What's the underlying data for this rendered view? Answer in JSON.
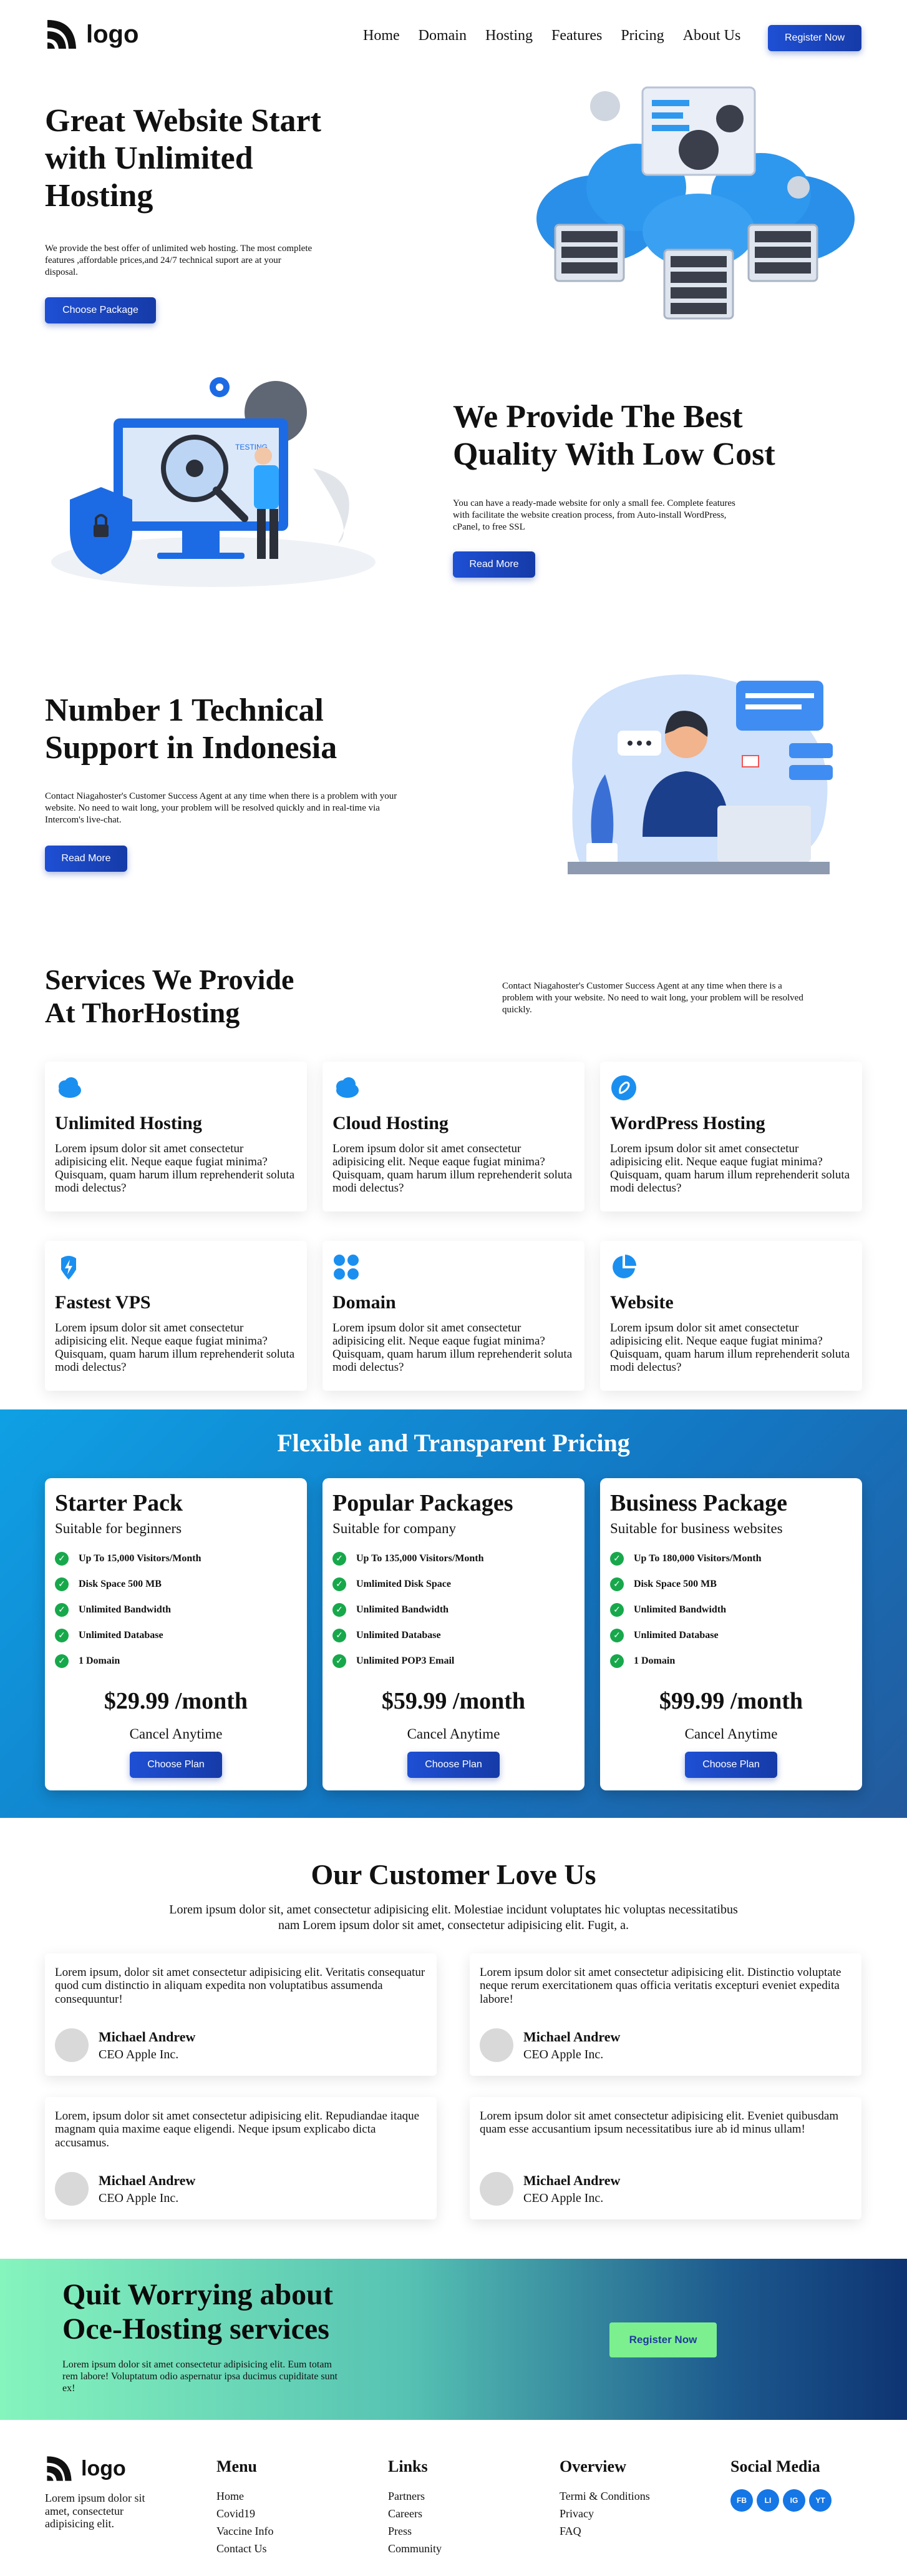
{
  "nav": {
    "logo": "logo",
    "items": [
      "Home",
      "Domain",
      "Hosting",
      "Features",
      "Pricing",
      "About Us"
    ],
    "register": "Register Now"
  },
  "hero": {
    "title_lines": [
      "Great Website Start",
      "with Unlimited",
      "Hosting"
    ],
    "text": "We provide the best offer of unlimited web hosting. The most complete features ,affordable prices,and 24/7 technical suport are at your disposal.",
    "button": "Choose Package"
  },
  "quality": {
    "title_lines": [
      "We Provide The Best",
      "Quality With Low Cost"
    ],
    "text": "You can have a ready-made website for only a small fee. Complete features with facilitate the website creation process, from Auto-install WordPress, cPanel, to free SSL",
    "button": "Read More",
    "illustration_label": "TESTING"
  },
  "support": {
    "title_lines": [
      "Number 1 Technical",
      "Support in Indonesia"
    ],
    "text": "Contact Niagahoster's Customer Success Agent at any time when there is a problem with your website. No need to wait long, your problem will be resolved quickly and in real-time via Intercom's live-chat.",
    "button": "Read More"
  },
  "services": {
    "title_lines": [
      "Services We Provide",
      "At ThorHosting"
    ],
    "intro": "Contact Niagahoster's Customer Success Agent at any time when there is a problem with your website. No need to wait long, your problem will be resolved quickly.",
    "items": [
      {
        "title": "Unlimited Hosting",
        "icon": "cloud-icon",
        "text": "Lorem ipsum dolor sit amet consectetur adipisicing elit. Neque eaque fugiat minima? Quisquam, quam harum illum reprehenderit soluta modi delectus?"
      },
      {
        "title": "Cloud Hosting",
        "icon": "cloud-icon",
        "text": "Lorem ipsum dolor sit amet consectetur adipisicing elit. Neque eaque fugiat minima? Quisquam, quam harum illum reprehenderit soluta modi delectus?"
      },
      {
        "title": "WordPress Hosting",
        "icon": "wordpress-icon",
        "text": "Lorem ipsum dolor sit amet consectetur adipisicing elit. Neque eaque fugiat minima? Quisquam, quam harum illum reprehenderit soluta modi delectus?"
      },
      {
        "title": "Fastest VPS",
        "icon": "lightning-icon",
        "text": "Lorem ipsum dolor sit amet consectetur adipisicing elit. Neque eaque fugiat minima? Quisquam, quam harum illum reprehenderit soluta modi delectus?"
      },
      {
        "title": "Domain",
        "icon": "grid-icon",
        "text": "Lorem ipsum dolor sit amet consectetur adipisicing elit. Neque eaque fugiat minima? Quisquam, quam harum illum reprehenderit soluta modi delectus?"
      },
      {
        "title": "Website",
        "icon": "pie-icon",
        "text": "Lorem ipsum dolor sit amet consectetur adipisicing elit. Neque eaque fugiat minima? Quisquam, quam harum illum reprehenderit soluta modi delectus?"
      }
    ]
  },
  "pricing": {
    "title": "Flexible and Transparent Pricing",
    "plans": [
      {
        "name": "Starter Pack",
        "sub": "Suitable for beginners",
        "features": [
          "Up To 15,000 Visitors/Month",
          "Disk Space 500 MB",
          "Unlimited Bandwidth",
          "Unlimited Database",
          "1 Domain"
        ],
        "price": "$29.99 /month",
        "cancel": "Cancel Anytime",
        "button": "Choose Plan"
      },
      {
        "name": "Popular Packages",
        "sub": "Suitable for company",
        "features": [
          "Up To 135,000 Visitors/Month",
          "Umlimited Disk Space",
          "Unlimited Bandwidth",
          "Unlimited Database",
          "Unlimited POP3 Email"
        ],
        "price": "$59.99 /month",
        "cancel": "Cancel Anytime",
        "button": "Choose Plan"
      },
      {
        "name": "Business Package",
        "sub": "Suitable for business websites",
        "features": [
          "Up To 180,000 Visitors/Month",
          "Disk Space 500 MB",
          "Unlimited Bandwidth",
          "Unlimited Database",
          "1 Domain"
        ],
        "price": "$99.99 /month",
        "cancel": "Cancel Anytime",
        "button": "Choose Plan"
      }
    ]
  },
  "testimonials": {
    "title": "Our Customer Love Us",
    "sub": "Lorem ipsum dolor sit, amet consectetur adipisicing elit. Molestiae incidunt voluptates hic voluptas necessitatibus nam Lorem ipsum dolor sit amet, consectetur adipisicing elit. Fugit, a.",
    "items": [
      {
        "text": "Lorem ipsum, dolor sit amet consectetur adipisicing elit. Veritatis consequatur quod cum distinctio in aliquam expedita non voluptatibus assumenda consequuntur!",
        "name": "Michael Andrew",
        "role": "CEO Apple Inc."
      },
      {
        "text": "Lorem ipsum dolor sit amet consectetur adipisicing elit. Distinctio voluptate neque rerum exercitationem quas officia veritatis excepturi eveniet expedita labore!",
        "name": "Michael Andrew",
        "role": "CEO Apple Inc."
      },
      {
        "text": "Lorem, ipsum dolor sit amet consectetur adipisicing elit. Repudiandae itaque magnam quia maxime eaque eligendi. Neque ipsum explicabo dicta accusamus.",
        "name": "Michael Andrew",
        "role": "CEO Apple Inc."
      },
      {
        "text": "Lorem ipsum dolor sit amet consectetur adipisicing elit. Eveniet quibusdam quam esse accusantium ipsum necessitatibus iure ab id minus ullam!",
        "name": "Michael Andrew",
        "role": "CEO Apple Inc."
      }
    ]
  },
  "cta": {
    "title_lines": [
      "Quit Worrying about",
      "Oce-Hosting services"
    ],
    "text": "Lorem ipsum dolor sit amet consectetur adipisicing elit. Eum totam rem labore! Voluptatum odio aspernatur ipsa ducimus cupiditate sunt ex!",
    "button": "Register Now"
  },
  "footer": {
    "logo": "logo",
    "about": "Lorem ipsum dolor sit amet, consectetur adipisicing elit.",
    "menu_title": "Menu",
    "menu": [
      "Home",
      "Covid19",
      "Vaccine Info",
      "Contact Us"
    ],
    "links_title": "Links",
    "links": [
      "Partners",
      "Careers",
      "Press",
      "Community"
    ],
    "overview_title": "Overview",
    "overview": [
      "Termi & Conditions",
      "Privacy",
      "FAQ"
    ],
    "social_title": "Social Media",
    "social": [
      "FB",
      "LI",
      "IG",
      "YT"
    ]
  },
  "colors": {
    "primary": "#1e4fd4",
    "pricing_bg": "#1378c4",
    "check": "#17a84b",
    "cta_button": "#7cf08f"
  }
}
